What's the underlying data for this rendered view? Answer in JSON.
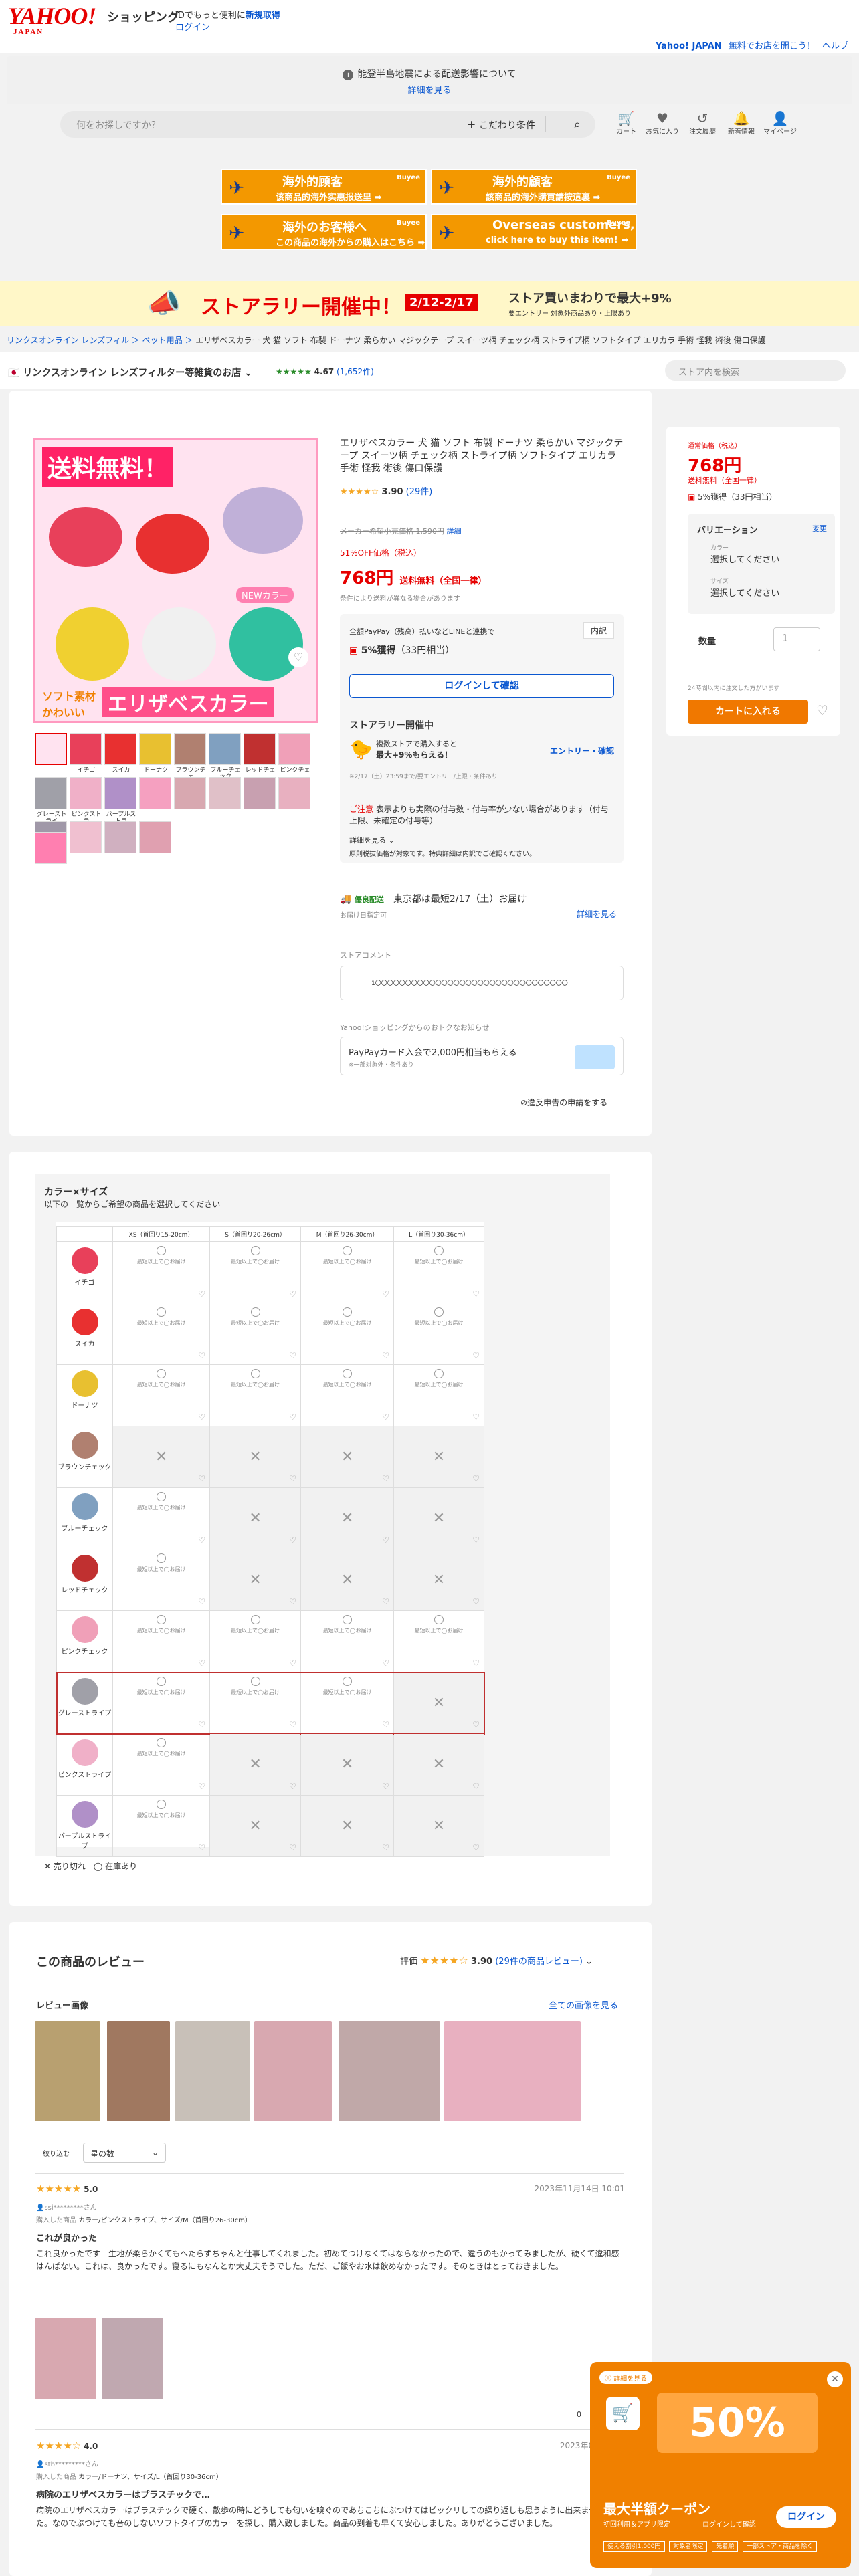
{
  "header": {
    "logo": "YAHOO!",
    "logo_sub": "JAPAN",
    "shopping": "ショッピング",
    "promo": "IDでもっと便利に",
    "new_reg": "新規取得",
    "login": "ログイン",
    "yj_link": "Yahoo! JAPAN",
    "yj_promo": "無料でお店を開こう！",
    "help": "ヘルプ"
  },
  "notice": {
    "text": "能登半島地震による配送影響について",
    "link": "詳細を見る"
  },
  "search": {
    "placeholder": "何をお探しですか？",
    "conditions": "こだわり条件"
  },
  "nav": [
    {
      "icon": "cart-icon",
      "label": "カート"
    },
    {
      "icon": "heart-icon",
      "label": "お気に入り"
    },
    {
      "icon": "history-icon",
      "label": "注文履歴"
    },
    {
      "icon": "bell-icon",
      "label": "新着情報"
    },
    {
      "icon": "user-icon",
      "label": "マイページ"
    }
  ],
  "banners": [
    {
      "t1": "海外的顾客",
      "t2": "该商品的海外实惠报送里 ➡"
    },
    {
      "t1": "海外的顧客",
      "t2": "該商品的海外購買請按這裏 ➡"
    },
    {
      "t1": "海外のお客様へ",
      "t2": "この商品の海外からの購入はこちら ➡"
    },
    {
      "t1": "Overseas customers,",
      "t2": "click here to buy this item! ➡"
    }
  ],
  "banner_brand": "Buyee",
  "rally": {
    "main": "ストアラリー開催中！",
    "dates": "2/12-2/17",
    "right": "ストア買いまわりで最大+9%",
    "sub": "要エントリー 対象外商品あり・上限あり"
  },
  "breadcrumb": {
    "items": [
      "リンクスオンライン レンズフィル",
      "ペット用品"
    ],
    "current": "エリザベスカラー 犬 猫 ソフト 布製 ドーナツ 柔らかい マジックテープ スイーツ柄 チェック柄 ストライプ柄 ソフトタイプ エリカラ 手術 怪我 術後 傷口保護"
  },
  "store": {
    "name": "リンクスオンライン レンズフィルター等雑貨のお店",
    "rating": "4.67",
    "count": "(1,652件)",
    "search_ph": "ストア内を検索"
  },
  "product": {
    "image_label1": "送料無料！",
    "image_label2": "エリザベスカラー",
    "image_label3": "ソフト素材 かわいい",
    "new_color": "NEWカラー",
    "title": "エリザベスカラー 犬 猫 ソフト 布製 ドーナツ 柔らかい マジックテープ スイーツ柄 チェック柄 ストライプ柄 ソフトタイプ エリカラ 手術 怪我 術後 傷口保護",
    "rating": "3.90",
    "review_count": "(29件)",
    "list_price": "メーカー希望小売価格 1,590円",
    "detail": "詳細",
    "discount": "51%OFF価格（税込）",
    "price": "768円",
    "shipping": "送料無料（全国一律）",
    "ship_note": "条件により送料が異なる場合があります",
    "paypay_head": "全額PayPay（残高）払いなどLINEと連携で",
    "breakdown": "内訳",
    "points": "5%獲得",
    "points_sub": "（33円相当）",
    "login_btn": "ログインして確認",
    "rally_head": "ストアラリー開催中",
    "rally_desc": "複数ストアで購入すると",
    "rally_max": "最大+9%もらえる！",
    "rally_entry": "エントリー・確認",
    "rally_note": "※2/17（土）23:59まで/要エントリー/上限・条件あり",
    "caution_head": "ご注意",
    "caution": "表示よりも実際の付与数・付与率が少ない場合があります（付与上限、未確定の付与等）",
    "more": "詳細を見る",
    "tax_note": "原則税抜価格が対象です。特典詳細は内訳でご確認ください。",
    "delivery_badge": "優良配送",
    "delivery": "東京都は最短2/17（土）お届け",
    "delivery_sub": "お届け日指定可",
    "delivery_more": "詳細を見る",
    "store_comment_label": "ストアコメント",
    "store_comment": "1〇〇〇〇〇〇〇〇〇〇〇〇〇〇〇〇〇〇〇〇〇〇〇〇〇〇〇〇〇〇〇〇",
    "card_label": "Yahoo!ショッピングからのおトクなお知らせ",
    "card_promo": "PayPayカード入会で2,000円相当もらえる",
    "card_sub": "※一部対象外・条件あり",
    "report": "違反申告の申請をする",
    "thumbs": [
      "イチゴ",
      "スイカ",
      "ドーナツ",
      "ブラウンチェ",
      "ブルーチェック",
      "レッドチェ",
      "ピンクチェ",
      "グレーストライ",
      "ピンクストラ",
      "パープルストラ"
    ]
  },
  "sidebar": {
    "price_label": "通常価格（税込）",
    "price": "768円",
    "shipping": "送料無料（全国一律）",
    "points": "5%獲得",
    "points_sub": "（33円相当）",
    "variation": "バリエーション",
    "change": "変更",
    "color_label": "カラー",
    "color_value": "選択してください",
    "size_label": "サイズ",
    "size_value": "選択してください",
    "qty_label": "数量",
    "qty": "1",
    "recent": "24時間以内に注文した方がいます",
    "cart_btn": "カートに入れる"
  },
  "variations": {
    "title": "カラー×サイズ",
    "subtitle": "以下の一覧からご希望の商品を選択してください",
    "sizes": [
      "XS（首回り15-20cm）",
      "S（首回り20-26cm）",
      "M（首回り26-30cm）",
      "L（首回り30-36cm）"
    ],
    "notify": "最短以上で◯お届け",
    "rows": [
      {
        "name": "イチゴ",
        "color": "#e8405a",
        "cells": [
          1,
          1,
          1,
          1
        ]
      },
      {
        "name": "スイカ",
        "color": "#e83030",
        "cells": [
          1,
          1,
          1,
          1
        ]
      },
      {
        "name": "ドーナツ",
        "color": "#e8c030",
        "cells": [
          1,
          1,
          1,
          1
        ]
      },
      {
        "name": "ブラウンチェック",
        "color": "#b08070",
        "cells": [
          0,
          0,
          0,
          0
        ]
      },
      {
        "name": "ブルーチェック",
        "color": "#80a0c0",
        "cells": [
          1,
          0,
          0,
          0
        ]
      },
      {
        "name": "レッドチェック",
        "color": "#c03030",
        "cells": [
          1,
          0,
          0,
          0
        ]
      },
      {
        "name": "ピンクチェック",
        "color": "#f0a0b8",
        "cells": [
          1,
          1,
          1,
          1
        ]
      },
      {
        "name": "グレーストライプ",
        "color": "#a0a0a8",
        "cells": [
          1,
          1,
          1,
          0
        ]
      },
      {
        "name": "ピンクストライプ",
        "color": "#f0b0c8",
        "cells": [
          1,
          0,
          0,
          0
        ]
      },
      {
        "name": "パープルストライプ",
        "color": "#b090c8",
        "cells": [
          1,
          0,
          0,
          0
        ]
      }
    ],
    "legend_x": "売り切れ",
    "legend_o": "在庫あり"
  },
  "reviews": {
    "title": "この商品のレビュー",
    "eval": "評価",
    "rating": "3.90",
    "count": "(29件の商品レビュー)",
    "img_title": "レビュー画像",
    "img_all": "全ての画像を見る",
    "filter_label": "絞り込む",
    "filter_value": "星の数",
    "items": [
      {
        "stars": "5.0",
        "date": "2023年11月14日 10:01",
        "user": "ssi*********さん",
        "purchase": "カラー/ピンクストライプ、サイズ/M（首回り26-30cm）",
        "title": "これが良かった",
        "body": "これ良かったです　生地が柔らかくてもへたらずちゃんと仕事してくれました。初めてつけなくてはならなかったので、違うのもかってみましたが、硬くて違和感はんぱない。これは、良かったです。寝るにもなんとか大丈夫そうでした。ただ、ご飯やお水は飲めなかったです。そのときはとっておきました。"
      },
      {
        "stars": "4.0",
        "date": "2023年05月20日",
        "user": "stb*********さん",
        "purchase": "カラー/ドーナツ、サイズ/L（首回り30-36cm）",
        "title": "病院のエリザベスカラーはプラスチックで…",
        "body": "病院のエリザベスカラーはプラスチックで硬く、散歩の時にどうしても匂いを嗅ぐのであちこちにぶつけてはビックリしての繰り返しも思うように出来ませんでした。なのでぶつけても音のしないソフトタイプのカラーを探し、購入致しました。商品の到着も早くて安心しました。ありがとうございました。"
      }
    ],
    "purchased_label": "購入した商品",
    "helpful": "0"
  },
  "coupon": {
    "tag": "詳細を見る",
    "percent": "50%",
    "title": "最大半額クーポン",
    "sub": "初回利用＆アプリ限定",
    "login_note": "ログインして確認",
    "login": "ログイン",
    "tags": [
      "使える割引1,000円",
      "対象者限定",
      "先着順",
      "一部ストア・商品を除く"
    ]
  }
}
